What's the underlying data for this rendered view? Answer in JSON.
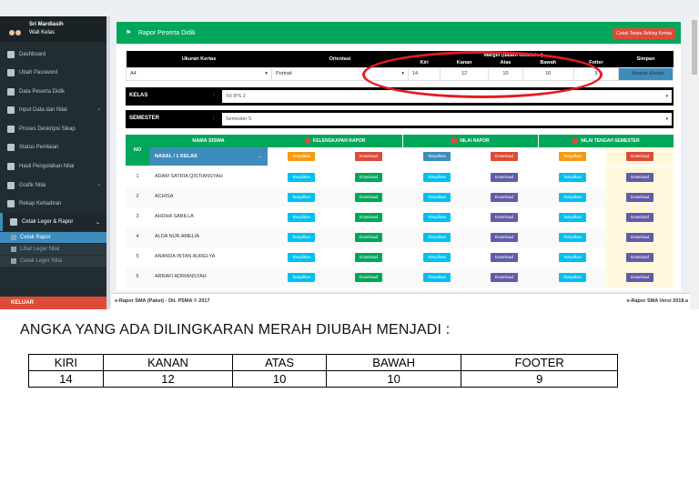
{
  "sidebar": {
    "user_name": "Sri Mardiasih",
    "user_role": "Wali Kelas",
    "items": [
      {
        "label": "Dashboard",
        "icon": "dashboard-icon"
      },
      {
        "label": "Ubah Password",
        "icon": "lock-icon"
      },
      {
        "label": "Data Peserta Didik",
        "icon": "user-icon"
      },
      {
        "label": "Input Data dan Nilai",
        "icon": "edit-icon",
        "arrow": "‹"
      },
      {
        "label": "Proses Deskripsi Sikap",
        "icon": "book-icon"
      },
      {
        "label": "Status Penilaian",
        "icon": "gear-icon"
      },
      {
        "label": "Hasil Pengolahan Nilai",
        "icon": "grid-icon"
      },
      {
        "label": "Grafik Nilai",
        "icon": "bar-chart-icon",
        "arrow": "‹"
      },
      {
        "label": "Rekap Kehadiran",
        "icon": "table-icon"
      },
      {
        "label": "Cetak Leger & Rapor",
        "icon": "print-icon",
        "arrow": "⌄"
      }
    ],
    "sub_items": [
      {
        "label": "Cetak Rapor",
        "icon": "print-icon"
      },
      {
        "label": "Lihat Leger Nilai",
        "icon": "list-icon"
      },
      {
        "label": "Cetak Leger Nilai",
        "icon": "print-icon"
      }
    ],
    "logout_label": "KELUAR"
  },
  "box": {
    "title": "Rapor Peserta Didik",
    "print_button": "Cetak Tanpa Setting Kertas"
  },
  "settings": {
    "headers": {
      "paper_size": "Ukuran Kertas",
      "orientation": "Orientasi",
      "margin_group": "Margin (dalam milimeter)",
      "kiri": "Kiri",
      "kanan": "Kanan",
      "atas": "Atas",
      "bawah": "Bawah",
      "footer": "Fotter",
      "save": "Simpan"
    },
    "values": {
      "paper_size": "A4",
      "orientation": "Portrait",
      "kiri": "14",
      "kanan": "12",
      "atas": "10",
      "bawah": "10",
      "footer": "9",
      "save_button": "Simpan Kertas"
    }
  },
  "kelas": {
    "label": "KELAS",
    "colon": ":",
    "value": "XII IPS 2"
  },
  "semester": {
    "label": "SEMESTER",
    "colon": ":",
    "value": "Semester 5"
  },
  "table": {
    "no_header": "NO",
    "nama_header": "NAMA SISWA",
    "kelas_header": "NASAL / 1 KELAS",
    "groups": [
      "KELENGKAPAN RAPOR",
      "NILAI RAPOR",
      "NILAI TENGAH SEMESTER"
    ],
    "tampilkan": "Tampilkan",
    "download": "Download",
    "rows": [
      {
        "no": "1",
        "name": "ADAM SATRIA QISTIANSYAH"
      },
      {
        "no": "2",
        "name": "ACHISA"
      },
      {
        "no": "3",
        "name": "AHDHA SABILLA"
      },
      {
        "no": "4",
        "name": "ALDA NUR AMELIA"
      },
      {
        "no": "5",
        "name": "ANANDA INTAN AURELYA"
      },
      {
        "no": "6",
        "name": "ARRAFI ADRIANSYAH"
      }
    ]
  },
  "footer": {
    "left": "e-Rapor SMA (Paket) - Dit. PSMA © 2017",
    "right": "e-Rapor SMA Versi 2018.a"
  },
  "note": {
    "text": "ANGKA YANG ADA DILINGKARAN MERAH DIUBAH MENJADI :",
    "headers": [
      "KIRI",
      "KANAN",
      "ATAS",
      "BAWAH",
      "FOOTER"
    ],
    "values": [
      "14",
      "12",
      "10",
      "10",
      "9"
    ]
  },
  "colors": {
    "green": "#00a65a",
    "blue": "#3c8dbc",
    "red": "#dd4b39",
    "annotation_red": "#e41b23"
  }
}
